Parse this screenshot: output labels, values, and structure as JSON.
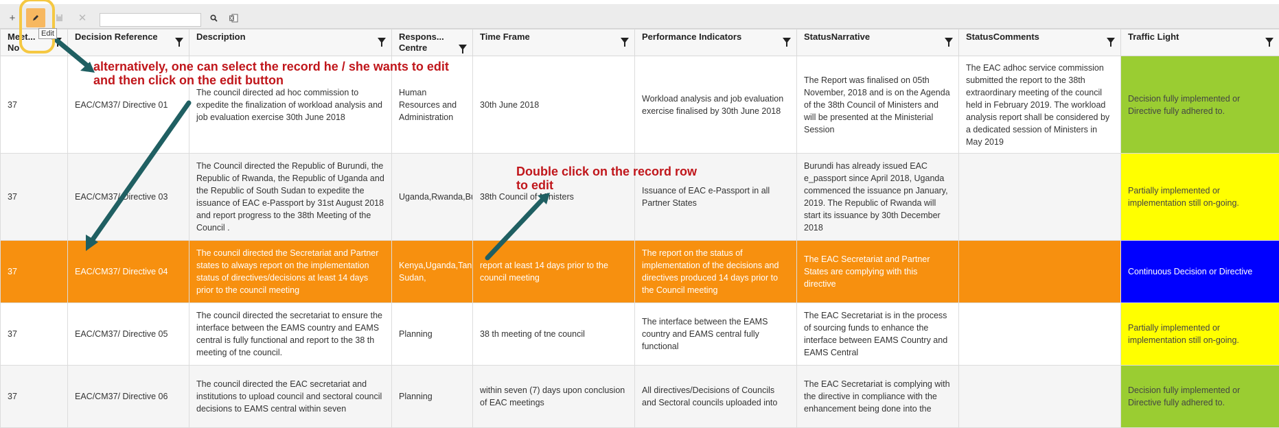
{
  "toolbar": {
    "add_icon": "plus-icon",
    "edit_icon": "pencil-icon",
    "save_icon": "save-icon",
    "delete_icon": "close-icon",
    "search_value": "",
    "search_icon": "search-icon",
    "export_icon": "excel-icon",
    "edit_tooltip": "Edit"
  },
  "grid": {
    "columns": [
      "Meet... No",
      "Decision Reference",
      "Description",
      "Respons... Centre",
      "Time Frame",
      "Performance Indicators",
      "StatusNarrative",
      "StatusComments",
      "Traffic Light"
    ],
    "rows": [
      {
        "meeting_no": "37",
        "reference": "EAC/CM37/ Directive 01",
        "description": " The council directed ad hoc commission to expedite the finalization of workload analysis and job evaluation exercise 30th June 2018",
        "centre": "Human Resources and Administration",
        "time_frame": "30th June 2018",
        "indicators": "Workload analysis and job evaluation exercise finalised by 30th June 2018",
        "narrative": "The Report was finalised on 05th November, 2018 and is on the Agenda of the 38th Council of Ministers and will be presented at the Ministerial Session",
        "comments": "The EAC adhoc service commission submitted the report to the 38th extraordinary meeting of the council held in February 2019. The workload analysis report shall be considered by a dedicated session of Ministers in May 2019",
        "traffic_light": "Decision fully implemented or Directive fully adhered to.",
        "light_color": "#9acd32"
      },
      {
        "meeting_no": "37",
        "reference": "EAC/CM37/ Directive 03",
        "description": "The Council directed the Republic of Burundi, the Republic of Rwanda, the Republic of Uganda and the Republic of South Sudan to expedite the issuance of EAC e-Passport by 31st August 2018 and report progress to the 38th Meeting of the Council .",
        "centre": "Uganda,Rwanda,Bu",
        "time_frame": "38th Council of Ministers",
        "indicators": "Issuance of EAC e-Passport in all Partner States",
        "narrative": "Burundi has already issued EAC e_passport since April 2018, Uganda commenced the issuance pn January, 2019. The Republic of Rwanda will start its issuance by 30th December 2018",
        "comments": "",
        "traffic_light": "Partially implemented or implementation still on-going.",
        "light_color": "#ffff00"
      },
      {
        "meeting_no": "37",
        "reference": "EAC/CM37/ Directive 04",
        "description": "The council directed the Secretariat and Partner states to always report on the implementation status of directives/decisions at least 14 days prior to the council meeting",
        "centre": "Kenya,Uganda,Tanz Sudan,",
        "time_frame": "report at least 14 days prior to the council meeting",
        "indicators": "The report on the status of implementation of the decisions and directives produced 14 days prior to the Council meeting",
        "narrative": "The EAC Secretariat and Partner States are complying with this directive",
        "comments": "",
        "traffic_light": "Continuous Decision or Directive",
        "light_color": "#0000ff"
      },
      {
        "meeting_no": "37",
        "reference": "EAC/CM37/ Directive 05",
        "description": "The council directed the secretariat to ensure the interface between the EAMS country and EAMS central is fully functional and report to the 38 th meeting of tne council.",
        "centre": "Planning",
        "time_frame": "38 th meeting of tne council",
        "indicators": "The interface between the EAMS country and EAMS central fully functional",
        "narrative": "The EAC Secretariat is in the process of sourcing funds to enhance the interface between EAMS Country and EAMS Central",
        "comments": "",
        "traffic_light": "Partially implemented or implementation still on-going.",
        "light_color": "#ffff00"
      },
      {
        "meeting_no": "37",
        "reference": "EAC/CM37/ Directive 06",
        "description": "The council directed the EAC secretariat and institutions to upload council and sectoral council decisions to EAMS central within seven",
        "centre": "Planning",
        "time_frame": "within seven (7) days upon conclusion of EAC meetings",
        "indicators": "All directives/Decisions of Councils and Sectoral councils uploaded into",
        "narrative": "The EAC Secretariat is complying with the directive in compliance with the enhancement being done into the",
        "comments": "",
        "traffic_light": "Decision fully implemented or Directive fully adhered to.",
        "light_color": "#9acd32"
      }
    ]
  },
  "annotations": {
    "edit_hint": "alternatively, one can select  the record he / she wants to edit and then click on the edit button",
    "dblclick_hint": "Double click on the record row to edit"
  }
}
